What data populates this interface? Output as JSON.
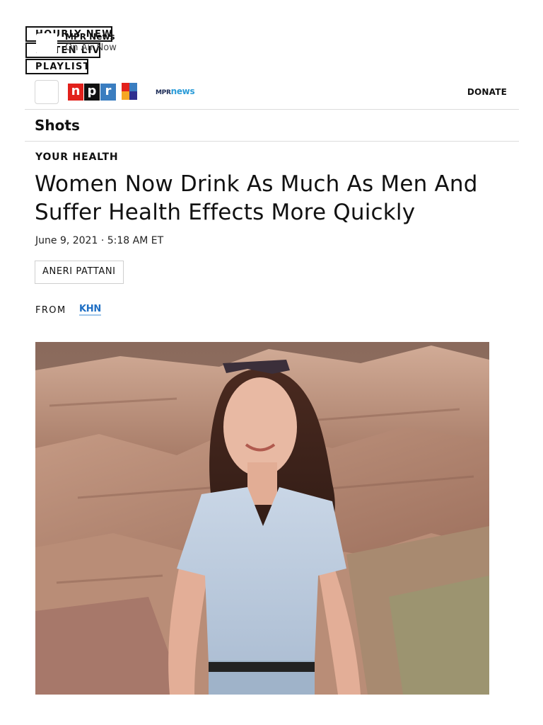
{
  "player": {
    "hourly_news": "Hourly News",
    "listen_live": "Listen Live",
    "playlist": "Playlist",
    "station": "MPR News",
    "status": "On Air Now"
  },
  "header": {
    "npr_letters": [
      "n",
      "p",
      "r"
    ],
    "partner_brand_prefix": "MPR",
    "partner_brand_suffix": "news",
    "donate": "DONATE",
    "colors": {
      "npr_red": "#e2211c",
      "npr_black": "#111111",
      "npr_blue": "#3a7dc0",
      "mpr_news_blue": "#2b9cd8"
    }
  },
  "section": {
    "title": "Shots"
  },
  "article": {
    "kicker": "YOUR HEALTH",
    "headline": "Women Now Drink As Much As Men And Suffer Health Effects More Quickly",
    "date": "June 9, 2021 · 5:18 AM ET",
    "author": "ANERI PATTANI",
    "from_label": "FROM",
    "source": "KHN"
  },
  "icons": {
    "menu": "menu-icon",
    "station_thumbnail": "station-thumbnail-icon",
    "npr_logo": "npr-logo",
    "brand_mosaic": "brand-mosaic-icon"
  }
}
